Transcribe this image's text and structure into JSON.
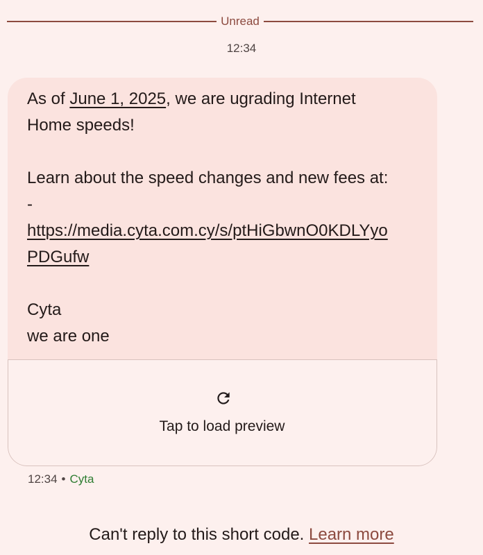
{
  "divider": {
    "label": "Unread"
  },
  "thread": {
    "timestamp": "12:34"
  },
  "message": {
    "line1_prefix": "As of ",
    "date_link": "June 1, 2025",
    "line1_suffix": ", we are ugrading Internet",
    "line2": "Home speeds!",
    "line3": "Learn about the speed changes and new fees at:",
    "line4": "-",
    "url_line1": "https://media.cyta.com.cy/s/ptHiGbwnO0KDLYyo",
    "url_line2": "PDGufw",
    "signature1": "Cyta",
    "signature2": "we are one",
    "icon_color": "#211a1a"
  },
  "preview": {
    "icon": "reload-icon",
    "label": "Tap to load preview"
  },
  "meta": {
    "time": "12:34",
    "separator": "•",
    "sender": "Cyta"
  },
  "footer": {
    "text": "Can't reply to this short code. ",
    "link": "Learn more"
  },
  "colors": {
    "background": "#fdf0ee",
    "bubble": "#fbe3df",
    "accent": "#8c4a3f",
    "sender": "#2e7d32"
  }
}
